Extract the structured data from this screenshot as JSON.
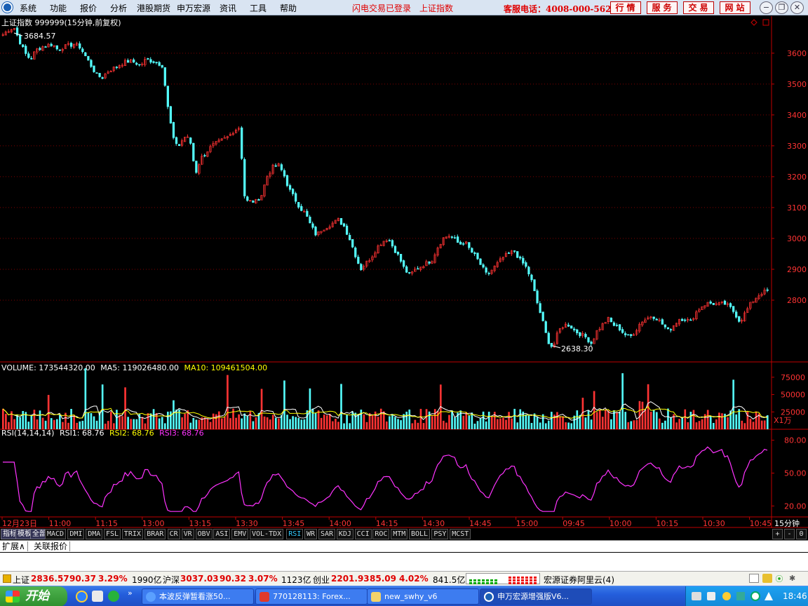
{
  "menu": {
    "items": [
      "系统",
      "功能",
      "报价",
      "分析",
      "港股期货",
      "申万宏源",
      "资讯",
      "工具",
      "帮助"
    ],
    "flash_status": "闪电交易已登录",
    "index_name": "上证指数",
    "phone": "客服电话：4008-000-562",
    "nav_buttons": [
      "行情",
      "服务",
      "交易",
      "网站"
    ]
  },
  "chart": {
    "title": "上证指数 999999(15分钟,前复权)",
    "high_label": "3684.57",
    "low_label": "2638.30",
    "price_ticks": [
      "3600",
      "3500",
      "3400",
      "3300",
      "3200",
      "3100",
      "3000",
      "2900",
      "2800"
    ],
    "volume_header": {
      "label": "VOLUME: 173544320.00",
      "ma5": "MA5: 119026480.00",
      "ma10": "MA10: 109461504.00"
    },
    "volume_ticks": [
      "75000",
      "50000",
      "25000"
    ],
    "volume_unit": "X1万",
    "rsi_header": {
      "label": "RSI(14,14,14)",
      "rsi1": "RSI1: 68.76",
      "rsi2": "RSI2: 68.76",
      "rsi3": "RSI3: 68.76"
    },
    "rsi_ticks": [
      "80.00",
      "50.00",
      "20.00"
    ],
    "time_labels": [
      "12月23日",
      "11:00",
      "11:15",
      "13:00",
      "13:15",
      "13:30",
      "13:45",
      "14:00",
      "14:15",
      "14:30",
      "14:45",
      "15:00",
      "09:45",
      "10:00",
      "10:15",
      "10:30",
      "10:45"
    ],
    "period": "15分钟",
    "colors": {
      "up": "#ff3333",
      "down": "#54fcfc",
      "ma5": "#ffffff",
      "ma10": "#ffff00",
      "rsi": "#ff33ff",
      "grid": "#800000",
      "axis": "#c00000"
    }
  },
  "chart_data": {
    "type": "candlestick",
    "title": "上证指数 999999(15分钟,前复权)",
    "y_range": [
      2600,
      3720
    ],
    "close_path": [
      3660,
      3675,
      3684,
      3640,
      3600,
      3580,
      3610,
      3620,
      3625,
      3630,
      3610,
      3620,
      3625,
      3630,
      3620,
      3590,
      3560,
      3530,
      3520,
      3540,
      3550,
      3560,
      3570,
      3575,
      3570,
      3560,
      3580,
      3575,
      3570,
      3560,
      3420,
      3320,
      3300,
      3330,
      3320,
      3210,
      3260,
      3280,
      3300,
      3310,
      3320,
      3330,
      3350,
      3360,
      3120,
      3120,
      3120,
      3140,
      3200,
      3230,
      3240,
      3210,
      3160,
      3130,
      3100,
      3080,
      3040,
      3010,
      3030,
      3040,
      3050,
      3060,
      3040,
      3000,
      2950,
      2900,
      2920,
      2940,
      2970,
      2990,
      3000,
      2970,
      2940,
      2900,
      2880,
      2900,
      2910,
      2920,
      2930,
      2970,
      3000,
      3010,
      3000,
      2980,
      2990,
      2960,
      2940,
      2910,
      2880,
      2900,
      2920,
      2940,
      2950,
      2960,
      2930,
      2910,
      2870,
      2800,
      2740,
      2670,
      2645,
      2700,
      2720,
      2720,
      2700,
      2690,
      2680,
      2660,
      2700,
      2720,
      2740,
      2720,
      2710,
      2690,
      2680,
      2700,
      2730,
      2740,
      2750,
      2740,
      2720,
      2700,
      2720,
      2740,
      2740,
      2730,
      2760,
      2780,
      2790,
      2790,
      2785,
      2790,
      2780,
      2760,
      2730,
      2760,
      2790,
      2810,
      2825,
      2830
    ]
  },
  "indicator_tabs": [
    "指标",
    "模板",
    "全部",
    "MACD",
    "DMI",
    "DMA",
    "FSL",
    "TRIX",
    "BRAR",
    "CR",
    "VR",
    "OBV",
    "ASI",
    "EMV",
    "VOL-TDX",
    "RSI",
    "WR",
    "SAR",
    "KDJ",
    "CCI",
    "ROC",
    "MTM",
    "BOLL",
    "PSY",
    "MCST"
  ],
  "active_tab": "RSI",
  "tab_controls": [
    "+",
    "-",
    "0"
  ],
  "ext_tabs": [
    "扩展∧",
    "关联报价"
  ],
  "status": {
    "sh_label": "上证",
    "sh_val": "2836.57",
    "sh_chg": "90.37",
    "sh_pct": "3.29%",
    "sh_amt": "1990亿",
    "hs_label": "沪深",
    "hs_val": "3037.03",
    "hs_chg": "90.32",
    "hs_pct": "3.07%",
    "hs_amt": "1123亿",
    "cy_label": "创业",
    "cy_val": "2201.93",
    "cy_chg": "85.09",
    "cy_pct": "4.02%",
    "cy_amt": "841.5亿",
    "server": "宏源证券阿里云(4)"
  },
  "taskbar": {
    "start": "开始",
    "items": [
      "本波反弹暂看涨50...",
      "770128113: Forex...",
      "new_swhy_v6",
      "申万宏源增强版V6..."
    ],
    "clock": "18:46"
  }
}
